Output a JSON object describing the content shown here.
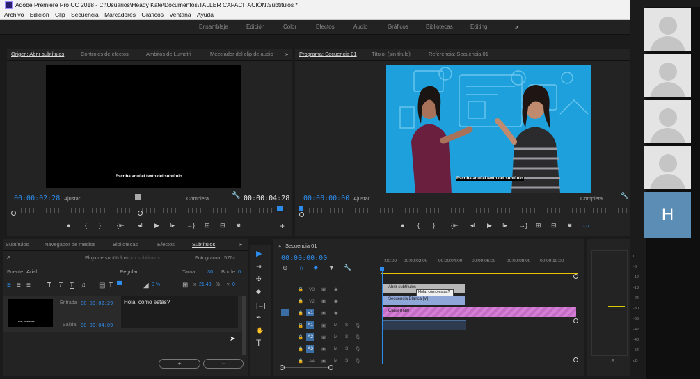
{
  "window": {
    "title": "Adobe Premiere Pro CC 2018 - C:\\Usuarios\\Heady Kate\\Documentos\\TALLER CAPACITACIÓN\\Subtitulos *"
  },
  "menu": [
    "Archivo",
    "Edición",
    "Clip",
    "Secuencia",
    "Marcadores",
    "Gráficos",
    "Ventana",
    "Ayuda"
  ],
  "workspaces": [
    "Ensamblaje",
    "Edición",
    "Color",
    "Efectos",
    "Audio",
    "Gráficos",
    "Bibliotecas",
    "Editing",
    "»"
  ],
  "source_panel": {
    "tabs": [
      "Origen: Abrir subtítulos",
      "Controles de efectos",
      "Ámbitos de Lumetri",
      "Mezclador del clip de audio",
      "»"
    ],
    "subtitle": "Escriba aquí el texto del subtítulo",
    "timecode_in": "00:00:02:28",
    "fit": "Ajustar",
    "quality": "Completa",
    "timecode_out": "00:00:04:28"
  },
  "program_panel": {
    "tabs": [
      "Programa: Secuencia 01",
      "Título: (sin título)",
      "Referencia: Secuencia 01"
    ],
    "subtitle": "Escriba aquí el texto del subtítulo",
    "timecode": "00:00:00:00",
    "fit": "Ajustar",
    "quality": "Completa"
  },
  "captions_panel": {
    "tabs": [
      "Subtítulos",
      "Navegador de medios",
      "Bibliotecas",
      "Efectos",
      "Subtítulos",
      "»"
    ],
    "search_placeholder": "",
    "stream_label": "Flujo de subtítulos",
    "stream_value": "Abrir subtítulos",
    "frame_label": "Fotograma",
    "frame_value": "576x",
    "font_label": "Fuente",
    "font_value": "Arial",
    "style_value": "Regular",
    "size_label": "Tama",
    "size_value": "30",
    "border_label": "Borde",
    "border_value": "0",
    "opacity": "0 %",
    "x_value": "21.48",
    "x_unit": "%",
    "y_label": "y",
    "y_value": "0",
    "entry_label": "Entrada",
    "entry_tc": "00:00:02:29",
    "exit_label": "Salida",
    "exit_tc": "00:00:04:09",
    "caption_text": "Hola, cómo estás?",
    "thumb_text": "Hola, cómo estás?",
    "btn_add": "+",
    "btn_remove": "−"
  },
  "timeline": {
    "tab": "Secuencia 01",
    "timecode": "00:00:00:00",
    "ruler": [
      ":00:00",
      "00:00:02:00",
      "00:00:04:00",
      "00:00:06:00",
      "00:00:08:00",
      "00:00:10:00"
    ],
    "video_tracks": [
      "V3",
      "V2",
      "V1"
    ],
    "audio_tracks": [
      "A1",
      "A2",
      "A3",
      "A4"
    ],
    "track_m": "M",
    "track_s": "S",
    "clips": {
      "caption": "Abrir subtítulos",
      "caption_tooltip": "Hola, cómo estás?",
      "black": "Secuencia Blanca [V]",
      "color": "Clase mate"
    }
  },
  "audio_meter": {
    "scale": [
      "0",
      "-6",
      "-12",
      "-18",
      "-24",
      "-30",
      "-36",
      "-42",
      "-48",
      "-54",
      "dB"
    ],
    "solo": [
      "S",
      "S"
    ]
  },
  "participants": {
    "avatar_letter": "H"
  }
}
